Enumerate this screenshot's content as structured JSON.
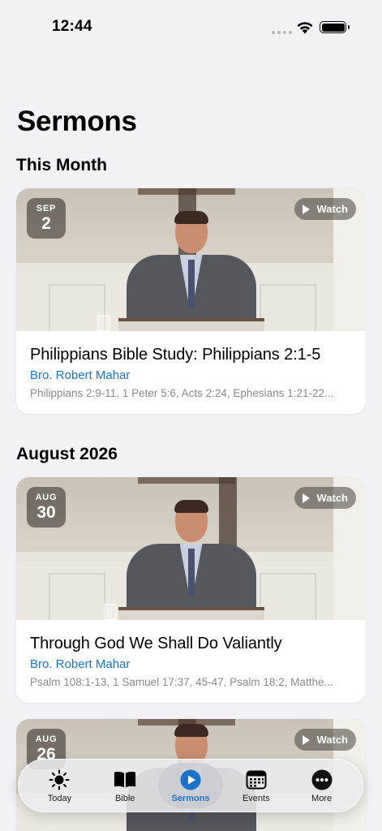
{
  "status_bar": {
    "time": "12:44"
  },
  "page": {
    "title": "Sermons"
  },
  "sections": [
    {
      "title": "This Month",
      "cards": [
        {
          "month": "SEP",
          "day": "2",
          "watch_label": "Watch",
          "title": "Philippians Bible Study: Philippians 2:1-5",
          "speaker": "Bro. Robert Mahar",
          "references": "Philippians 2:9-11, 1 Peter 5:6, Acts 2:24, Ephesians 1:21-22..."
        }
      ]
    },
    {
      "title": "August 2026",
      "cards": [
        {
          "month": "AUG",
          "day": "30",
          "watch_label": "Watch",
          "title": "Through God We Shall Do Valiantly",
          "speaker": "Bro. Robert Mahar",
          "references": "Psalm 108:1-13, 1 Samuel 17:37, 45-47, Psalm 18:2, Matthe..."
        },
        {
          "month": "AUG",
          "day": "26",
          "watch_label": "Watch"
        }
      ]
    }
  ],
  "tab_bar": {
    "active": "Sermons",
    "tabs": [
      {
        "label": "Today",
        "icon": "sun-icon"
      },
      {
        "label": "Bible",
        "icon": "book-icon"
      },
      {
        "label": "Sermons",
        "icon": "play-circle-icon"
      },
      {
        "label": "Events",
        "icon": "calendar-icon"
      },
      {
        "label": "More",
        "icon": "ellipsis-circle-icon"
      }
    ]
  },
  "colors": {
    "accent": "#1a73c8",
    "background": "#f2f2f6"
  }
}
